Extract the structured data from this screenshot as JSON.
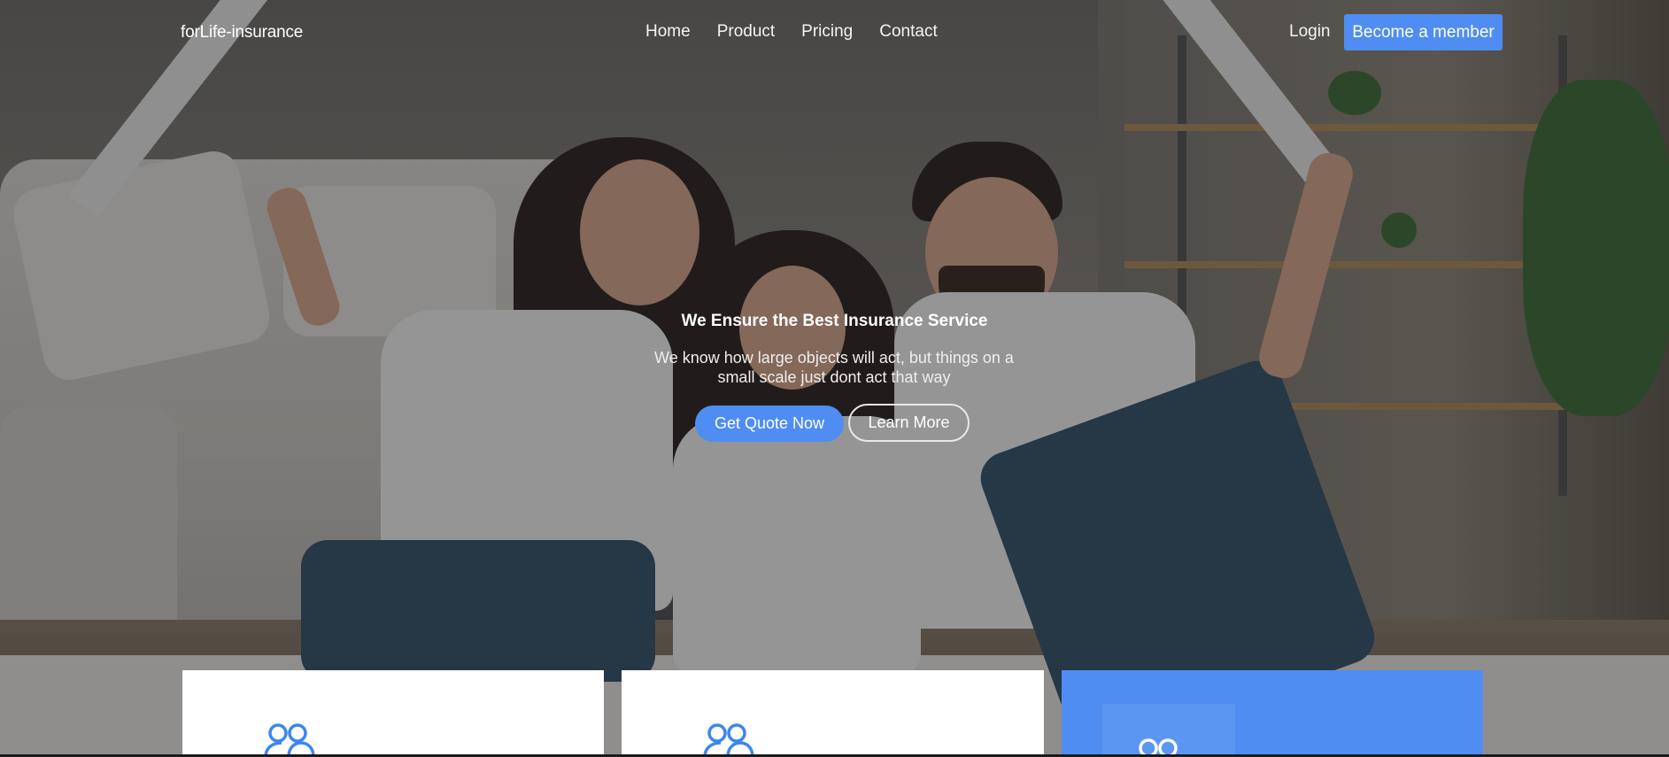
{
  "navbar": {
    "brand": "forLife-insurance",
    "links": [
      "Home",
      "Product",
      "Pricing",
      "Contact"
    ],
    "login": "Login",
    "cta": "Become a member"
  },
  "hero": {
    "title": "We Ensure the Best Insurance Service",
    "subtitle": "We know how large objects will act, but things on a small scale just dont act that way",
    "primary_button": "Get Quote Now",
    "secondary_button": "Learn More",
    "background_image": "family-under-roof-photo"
  },
  "cards": [
    {
      "style": "white",
      "icon": "people-icon"
    },
    {
      "style": "white",
      "icon": "people-icon"
    },
    {
      "style": "blue",
      "icon": "people-icon"
    }
  ],
  "colors": {
    "accent": "#4f8df2",
    "card_white": "#ffffff",
    "icon_blue": "#3d86ef"
  }
}
